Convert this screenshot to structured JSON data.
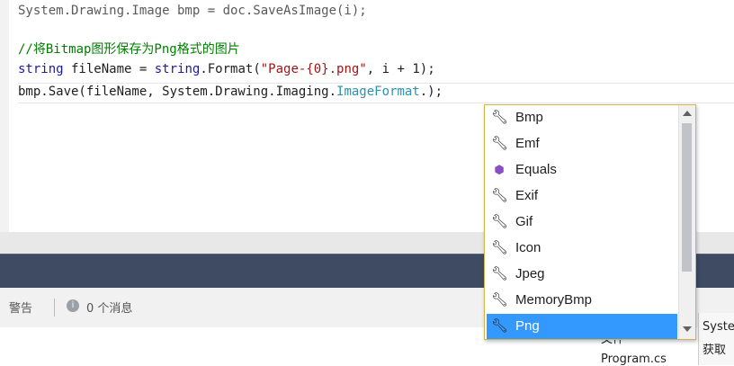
{
  "editor": {
    "line_top": "System.Drawing.Image bmp = doc.SaveAsImage(i);",
    "comment": "//将Bitmap图形保存为Png格式的图片",
    "line_string": {
      "kw1": "string",
      "mid": " fileName = ",
      "kw2": "string",
      "mid2": ".Format(",
      "str": "\"Page-{0}.png\"",
      "end": ", i + 1);"
    },
    "line_save": {
      "start": "bmp.Save(fileName, System.Drawing.Imaging.",
      "type": "ImageFormat",
      "end": ".);"
    }
  },
  "intellisense": {
    "items": [
      {
        "label": "Bmp",
        "icon": "wrench-icon"
      },
      {
        "label": "Emf",
        "icon": "wrench-icon"
      },
      {
        "label": "Equals",
        "icon": "method-icon"
      },
      {
        "label": "Exif",
        "icon": "wrench-icon"
      },
      {
        "label": "Gif",
        "icon": "wrench-icon"
      },
      {
        "label": "Icon",
        "icon": "wrench-icon"
      },
      {
        "label": "Jpeg",
        "icon": "wrench-icon"
      },
      {
        "label": "MemoryBmp",
        "icon": "wrench-icon"
      },
      {
        "label": "Png",
        "icon": "wrench-icon",
        "selected": true
      }
    ],
    "selection_color": "#3399ff"
  },
  "error_list": {
    "warnings_label": "警告",
    "messages_label": "0 个消息"
  },
  "bottom": {
    "file_col": "文件",
    "program_cs": "Program.cs"
  },
  "right_panel": {
    "line1": "Syste",
    "line2": "获取"
  }
}
